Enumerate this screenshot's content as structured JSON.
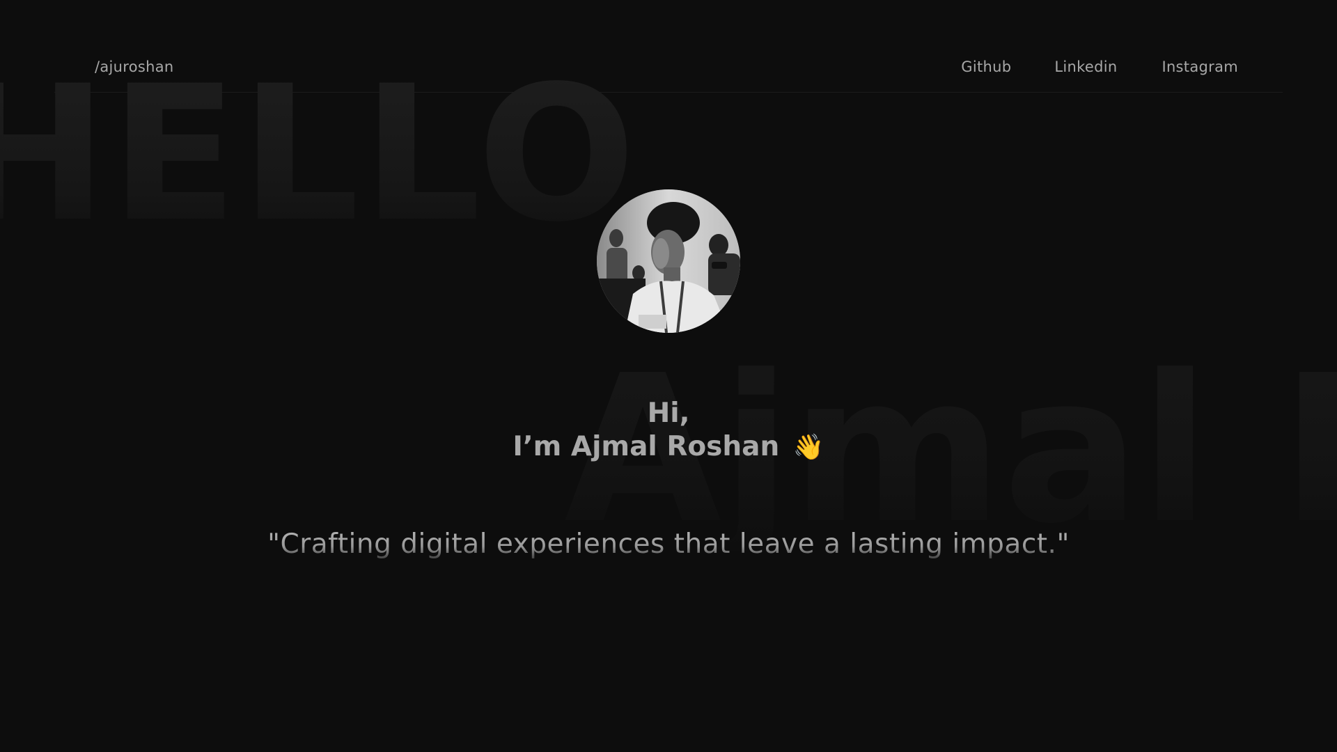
{
  "background": {
    "hello_word": "HELLO",
    "name_word": "Ajmal R"
  },
  "header": {
    "logo": "/ajuroshan",
    "nav": {
      "github": "Github",
      "linkedin": "Linkedin",
      "instagram": "Instagram"
    }
  },
  "hero": {
    "greeting_line1": "Hi,",
    "greeting_line2": "I’m Ajmal Roshan",
    "wave_emoji": "👋",
    "quote": "\"Crafting digital experiences that leave a lasting impact.\""
  },
  "colors": {
    "background": "#0d0d0d",
    "text": "#a9a9a9",
    "accent_emoji": "#e8b14a"
  }
}
